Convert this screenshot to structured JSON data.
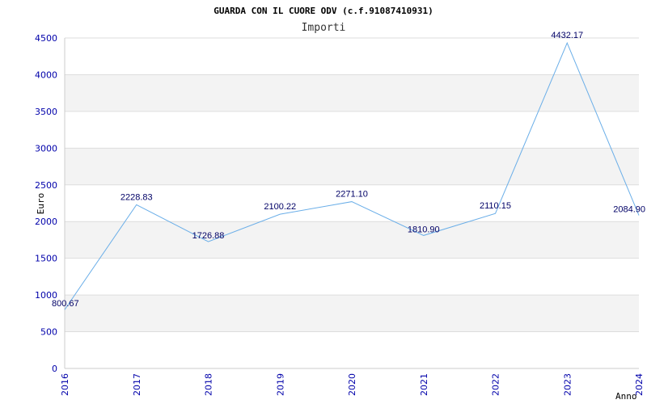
{
  "chart_data": {
    "type": "line",
    "title": "GUARDA CON IL CUORE ODV (c.f.91087410931)",
    "subtitle": "Importi",
    "xlabel": "Anno",
    "ylabel": "Euro",
    "ylim": [
      0,
      4500
    ],
    "yticks": [
      "0",
      "500",
      "1000",
      "1500",
      "2000",
      "2500",
      "3000",
      "3500",
      "4000",
      "4500"
    ],
    "categories": [
      "2016",
      "2017",
      "2018",
      "2019",
      "2020",
      "2021",
      "2022",
      "2023",
      "2024"
    ],
    "values": [
      800.67,
      2228.83,
      1726.88,
      2100.22,
      2271.1,
      1810.9,
      2110.15,
      4432.17,
      2084.9
    ],
    "data_labels": [
      "800.67",
      "2228.83",
      "1726.88",
      "2100.22",
      "2271.10",
      "1810.90",
      "2110.15",
      "4432.17",
      "2084.90"
    ],
    "grid": true,
    "colors": {
      "line": "#6aaee8",
      "band": "#f3f3f3",
      "gridline": "#dddddd",
      "axis": "#cccccc",
      "tick_text": "#0000aa"
    }
  }
}
